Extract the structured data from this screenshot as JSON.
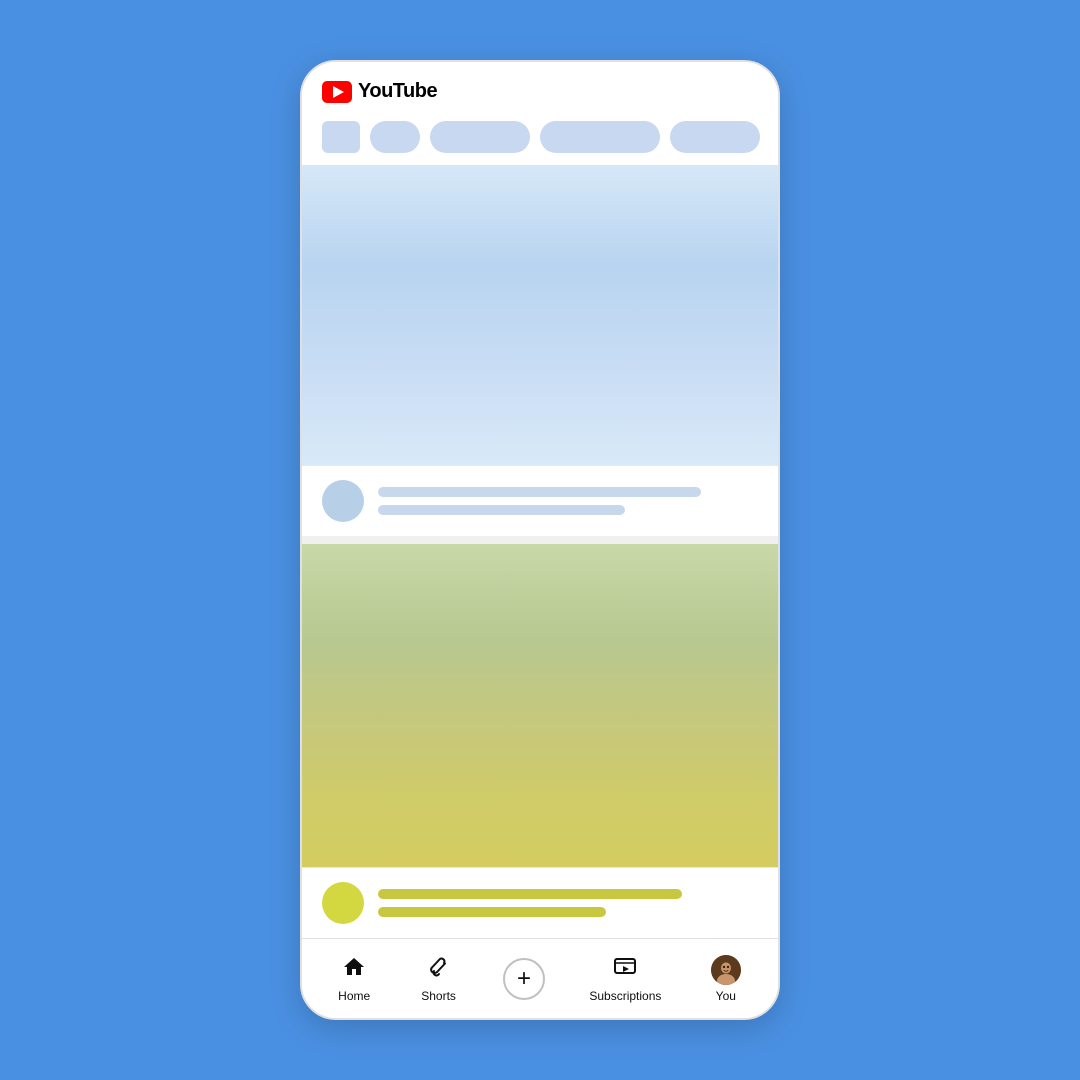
{
  "app": {
    "name": "YouTube",
    "background_color": "#4a90e2"
  },
  "header": {
    "logo_text": "YouTube",
    "logo_icon": "youtube-icon"
  },
  "filter_chips": {
    "chips": [
      {
        "type": "square",
        "label": ""
      },
      {
        "type": "circle",
        "label": ""
      },
      {
        "type": "pill-md",
        "label": ""
      },
      {
        "type": "pill-lg",
        "label": ""
      },
      {
        "type": "pill-xl",
        "label": ""
      }
    ]
  },
  "content": {
    "video_card_1": {
      "thumbnail_style": "blue-gradient",
      "channel_avatar_style": "blue-skeleton",
      "title_line_1": "",
      "title_line_2": ""
    },
    "video_card_2": {
      "thumbnail_style": "green-yellow-gradient",
      "channel_avatar_style": "yellow-circle",
      "title_line_1": "",
      "title_line_2": ""
    }
  },
  "bottom_nav": {
    "items": [
      {
        "id": "home",
        "label": "Home",
        "icon": "home-icon"
      },
      {
        "id": "shorts",
        "label": "Shorts",
        "icon": "shorts-icon"
      },
      {
        "id": "create",
        "label": "",
        "icon": "plus-icon"
      },
      {
        "id": "subscriptions",
        "label": "Subscriptions",
        "icon": "subscriptions-icon"
      },
      {
        "id": "you",
        "label": "You",
        "icon": "avatar-icon"
      }
    ]
  }
}
